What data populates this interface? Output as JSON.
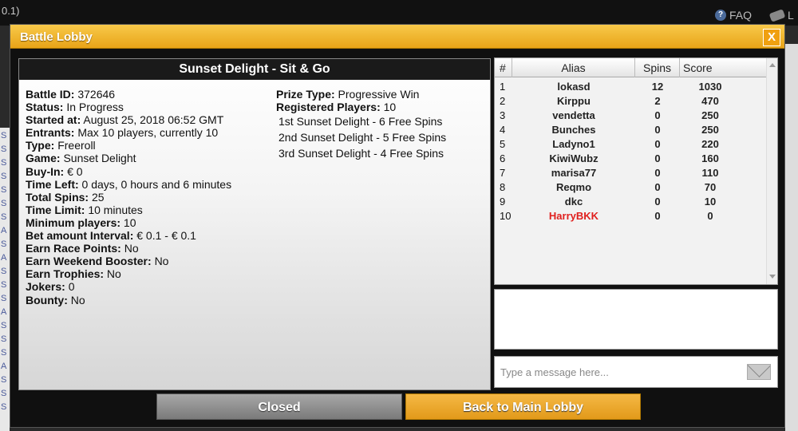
{
  "background": {
    "top_left_text": "0.1)",
    "faq_label": "FAQ",
    "faq_icon": "question-icon",
    "right_link_label": "L",
    "left_col_letters": [
      "S",
      "S",
      "S",
      "S",
      "S",
      "S",
      "S",
      "A",
      "S",
      "A",
      "S",
      "S",
      "S",
      "A",
      "S",
      "S",
      "S",
      "A",
      "S",
      "S",
      "S"
    ]
  },
  "modal": {
    "title": "Battle Lobby",
    "close_label": "X"
  },
  "battle": {
    "header": "Sunset Delight - Sit & Go",
    "details": [
      {
        "label": "Battle ID:",
        "value": "372646"
      },
      {
        "label": "Status:",
        "value": "In Progress"
      },
      {
        "label": "Started at:",
        "value": "August 25, 2018 06:52 GMT"
      },
      {
        "label": "Entrants:",
        "value": "Max 10 players, currently 10"
      },
      {
        "label": "Type:",
        "value": "Freeroll"
      },
      {
        "label": "Game:",
        "value": "Sunset Delight"
      },
      {
        "label": "Buy-In:",
        "value": "€ 0"
      },
      {
        "label": "Time Left:",
        "value": "0 days, 0 hours and 6 minutes"
      },
      {
        "label": "Total Spins:",
        "value": "25"
      },
      {
        "label": "Time Limit:",
        "value": "10 minutes"
      },
      {
        "label": "Minimum players:",
        "value": "10"
      },
      {
        "label": "Bet amount Interval:",
        "value": "€ 0.1 - € 0.1"
      },
      {
        "label": "Earn Race Points:",
        "value": "No"
      },
      {
        "label": "Earn Weekend Booster:",
        "value": "No"
      },
      {
        "label": "Earn Trophies:",
        "value": "No"
      },
      {
        "label": "Jokers:",
        "value": "0"
      },
      {
        "label": "Bounty:",
        "value": "No"
      }
    ],
    "prize_type_label": "Prize Type:",
    "prize_type_value": "Progressive Win",
    "registered_label": "Registered Players:",
    "registered_value": "10",
    "prizes": [
      "1st  Sunset Delight - 6 Free Spins",
      "2nd  Sunset Delight - 5 Free Spins",
      "3rd  Sunset Delight - 4 Free Spins"
    ]
  },
  "leaderboard": {
    "headers": {
      "num": "#",
      "alias": "Alias",
      "spins": "Spins",
      "score": "Score"
    },
    "rows": [
      {
        "num": "1",
        "alias": "lokasd",
        "spins": "12",
        "score": "1030"
      },
      {
        "num": "2",
        "alias": "Kirppu",
        "spins": "2",
        "score": "470"
      },
      {
        "num": "3",
        "alias": "vendetta",
        "spins": "0",
        "score": "250"
      },
      {
        "num": "4",
        "alias": "Bunches",
        "spins": "0",
        "score": "250"
      },
      {
        "num": "5",
        "alias": "Ladyno1",
        "spins": "0",
        "score": "220"
      },
      {
        "num": "6",
        "alias": "KiwiWubz",
        "spins": "0",
        "score": "160"
      },
      {
        "num": "7",
        "alias": "marisa77",
        "spins": "0",
        "score": "110"
      },
      {
        "num": "8",
        "alias": "Reqmo",
        "spins": "0",
        "score": "70"
      },
      {
        "num": "9",
        "alias": "dkc",
        "spins": "0",
        "score": "10"
      },
      {
        "num": "10",
        "alias": "HarryBKK",
        "spins": "0",
        "score": "0",
        "highlight": true
      }
    ],
    "highlight_color": "#e0201e"
  },
  "chat": {
    "placeholder": "Type a message here...",
    "send_icon": "envelope-icon"
  },
  "buttons": {
    "closed_label": "Closed",
    "back_label": "Back to Main Lobby"
  },
  "colors": {
    "accent": "#f0a818",
    "button_grey": "#8c8c8c"
  }
}
